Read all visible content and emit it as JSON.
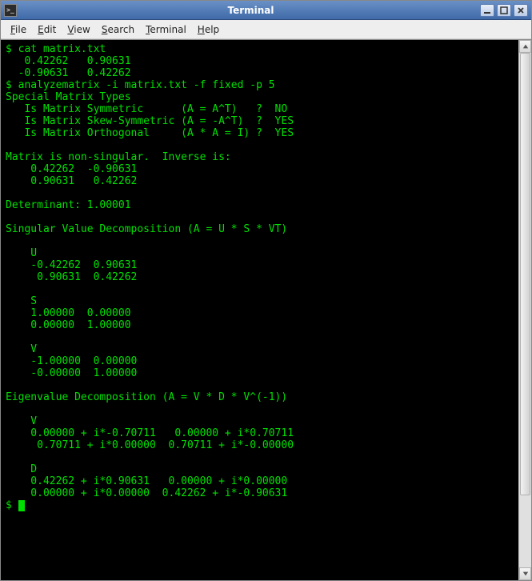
{
  "window": {
    "title": "Terminal"
  },
  "titlebar_buttons": {
    "minimize": "minimize",
    "maximize": "maximize",
    "close": "close"
  },
  "menu": {
    "file": "File",
    "edit": "Edit",
    "view": "View",
    "search": "Search",
    "terminal": "Terminal",
    "help": "Help"
  },
  "prompt": "$ ",
  "terminal_lines": [
    "$ cat matrix.txt",
    "   0.42262   0.90631",
    "  -0.90631   0.42262",
    "$ analyzematrix -i matrix.txt -f fixed -p 5",
    "Special Matrix Types",
    "   Is Matrix Symmetric      (A = A^T)   ?  NO",
    "   Is Matrix Skew-Symmetric (A = -A^T)  ?  YES",
    "   Is Matrix Orthogonal     (A * A = I) ?  YES",
    "",
    "Matrix is non-singular.  Inverse is:",
    "    0.42262  -0.90631",
    "    0.90631   0.42262",
    "",
    "Determinant: 1.00001",
    "",
    "Singular Value Decomposition (A = U * S * VT)",
    "",
    "    U",
    "    -0.42262  0.90631",
    "     0.90631  0.42262",
    "",
    "    S",
    "    1.00000  0.00000",
    "    0.00000  1.00000",
    "",
    "    V",
    "    -1.00000  0.00000",
    "    -0.00000  1.00000",
    "",
    "Eigenvalue Decomposition (A = V * D * V^(-1))",
    "",
    "    V",
    "    0.00000 + i*-0.70711   0.00000 + i*0.70711",
    "     0.70711 + i*0.00000  0.70711 + i*-0.00000",
    "",
    "    D",
    "    0.42262 + i*0.90631   0.00000 + i*0.00000",
    "    0.00000 + i*0.00000  0.42262 + i*-0.90631"
  ]
}
